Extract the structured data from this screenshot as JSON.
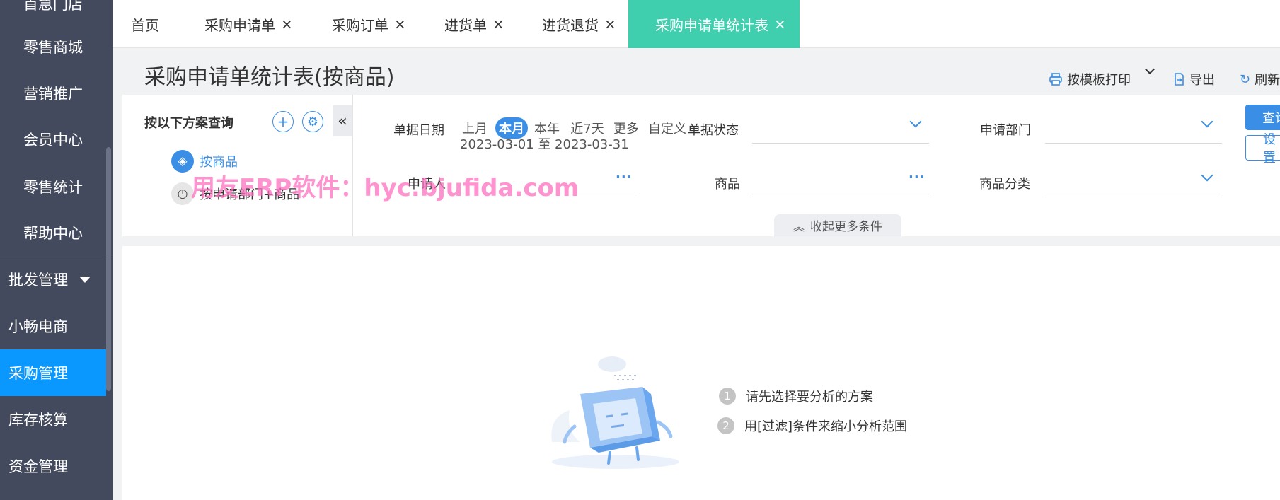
{
  "sidebar": {
    "items": [
      {
        "label": "首急门店"
      },
      {
        "label": "零售商城"
      },
      {
        "label": "营销推广"
      },
      {
        "label": "会员中心"
      },
      {
        "label": "零售统计"
      },
      {
        "label": "帮助中心"
      },
      {
        "label": "批发管理"
      },
      {
        "label": "小畅电商"
      },
      {
        "label": "采购管理"
      },
      {
        "label": "库存核算"
      },
      {
        "label": "资金管理"
      }
    ]
  },
  "tabs": [
    {
      "label": "首页"
    },
    {
      "label": "采购申请单"
    },
    {
      "label": "采购订单"
    },
    {
      "label": "进货单"
    },
    {
      "label": "进货退货"
    },
    {
      "label": "采购申请单统计表"
    }
  ],
  "tab_close": "×",
  "page": {
    "title": "采购申请单统计表(按商品)"
  },
  "toolbar": {
    "print": "按模板打印",
    "export": "导出",
    "refresh": "刷新"
  },
  "scheme": {
    "title": "按以下方案查询",
    "items": [
      {
        "label": "按商品"
      },
      {
        "label": "按申请部门+商品"
      }
    ]
  },
  "filters": {
    "date_label": "单据日期",
    "date_options": [
      "上月",
      "本月",
      "本年",
      "近7天",
      "更多",
      "自定义"
    ],
    "date_range": "2023-03-01 至 2023-03-31",
    "status_label": "单据状态",
    "dept_label": "申请部门",
    "applicant_label": "申请人",
    "product_label": "商品",
    "category_label": "商品分类",
    "collapse_more": "收起更多条件"
  },
  "buttons": {
    "query": "查询",
    "settings": "设置"
  },
  "watermark": "用友ERP软件：hyc.bjufida.com",
  "empty_state": {
    "steps": [
      {
        "num": "1",
        "text": "请先选择要分析的方案"
      },
      {
        "num": "2",
        "text": "用[过滤]条件来缩小分析范围"
      }
    ]
  },
  "colors": {
    "accent": "#3a8ee6",
    "active_tab": "#3fcfae",
    "sidebar_bg": "#444a5e",
    "sidebar_active": "#0a98ff"
  }
}
